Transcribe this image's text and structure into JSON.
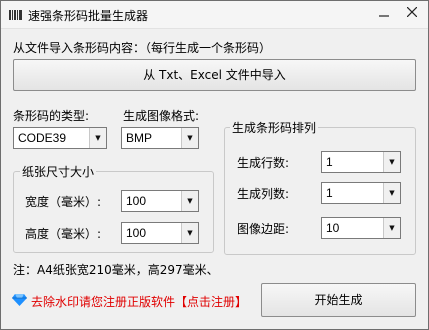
{
  "window": {
    "title": "速强条形码批量生成器"
  },
  "import": {
    "label": "从文件导入条形码内容：（每行生成一个条形码）",
    "button": "从 Txt、Excel 文件中导入"
  },
  "barcode_type": {
    "label": "条形码的类型:",
    "value": "CODE39"
  },
  "image_format": {
    "label": "生成图像格式:",
    "value": "BMP"
  },
  "paper_size": {
    "title": "纸张尺寸大小",
    "width_label": "宽度（毫米）:",
    "width_value": "100",
    "height_label": "高度（毫米）:",
    "height_value": "100"
  },
  "layout": {
    "title": "生成条形码排列",
    "rows_label": "生成行数:",
    "rows_value": "1",
    "cols_label": "生成列数:",
    "cols_value": "1",
    "margin_label": "图像边距:",
    "margin_value": "10"
  },
  "note": "注：A4纸张宽210毫米，高297毫米、",
  "register": {
    "text_prefix": "去除水印请您注册正版软件",
    "link": "【点击注册】"
  },
  "generate_button": "开始生成",
  "colors": {
    "register_text": "#e00000",
    "gem": "#1e90ff"
  }
}
